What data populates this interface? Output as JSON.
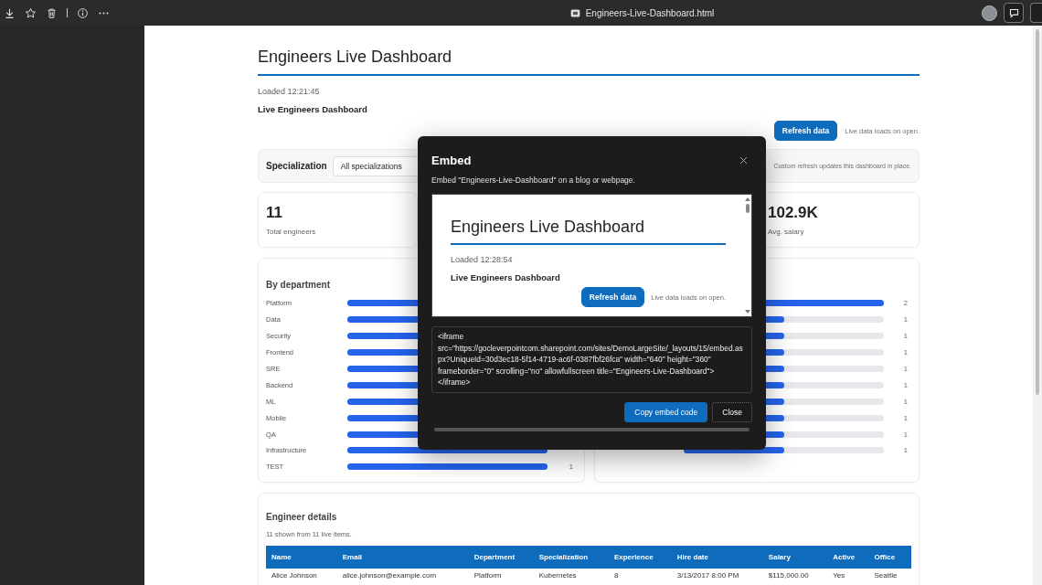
{
  "browser": {
    "tab_title": "Engineers-Live-Dashboard.html"
  },
  "page": {
    "title": "Engineers Live Dashboard",
    "loaded": "Loaded 12:21:45",
    "subtitle": "Live Engineers Dashboard",
    "refresh_button": "Refresh data",
    "refresh_note": "Live data loads on open.",
    "filter": {
      "label": "Specialization",
      "value": "All specializations",
      "note": "Custom refresh updates this dashboard in place."
    },
    "stats": [
      {
        "value": "11",
        "label": "Total engineers"
      },
      {
        "value": "102.9K",
        "label": "Avg. salary"
      }
    ],
    "charts": [
      {
        "title": "By department",
        "rows": [
          {
            "label": "Platform",
            "level": 1
          },
          {
            "label": "Data",
            "level": 1
          },
          {
            "label": "Security",
            "level": 1
          },
          {
            "label": "Frontend",
            "level": 1
          },
          {
            "label": "SRE",
            "level": 1
          },
          {
            "label": "Backend",
            "level": 1
          },
          {
            "label": "ML",
            "level": 1
          },
          {
            "label": "Mobile",
            "level": 1
          },
          {
            "label": "QA",
            "level": 1
          },
          {
            "label": "Infrastructure",
            "level": 1
          },
          {
            "label": "TEST",
            "level": 1,
            "value": "1"
          }
        ]
      },
      {
        "rows": [
          {
            "level": 1,
            "value": "2"
          },
          {
            "level": 0.5,
            "value": "1"
          },
          {
            "level": 0.5,
            "value": "1"
          },
          {
            "level": 0.5,
            "value": "1"
          },
          {
            "level": 0.5,
            "value": "1"
          },
          {
            "level": 0.5,
            "value": "1"
          },
          {
            "level": 0.5,
            "value": "1"
          },
          {
            "level": 0.5,
            "value": "1"
          },
          {
            "level": 0.5,
            "value": "1"
          },
          {
            "level": 0.5,
            "value": "1"
          }
        ]
      }
    ],
    "table": {
      "title": "Engineer details",
      "subtitle": "11 shown from 11 live items.",
      "columns": [
        "Name",
        "Email",
        "Department",
        "Specialization",
        "Experience",
        "Hire date",
        "Salary",
        "Active",
        "Office"
      ],
      "rows": [
        [
          "Alice Johnson",
          "alice.johnson@example.com",
          "Platform",
          "Kubernetes",
          "8",
          "3/13/2017 8:00 PM",
          "$115,000.00",
          "Yes",
          "Seattle"
        ]
      ]
    }
  },
  "modal": {
    "title": "Embed",
    "description": "Embed \"Engineers-Live-Dashboard\" on a blog or webpage.",
    "preview": {
      "title": "Engineers Live Dashboard",
      "loaded": "Loaded 12:28:54",
      "subtitle": "Live Engineers Dashboard",
      "button": "Refresh data",
      "note": "Live data loads on open."
    },
    "code": "<iframe src=\"https://gocleverpointcom.sharepoint.com/sites/DemoLargeSite/_layouts/15/embed.aspx?UniqueId=30d3ec18-5f14-4719-ac6f-0387fbf26fca\" width=\"640\" height=\"360\" frameborder=\"0\" scrolling=\"no\" allowfullscreen title=\"Engineers-Live-Dashboard\"></iframe>",
    "buttons": [
      {
        "label": "Copy embed code",
        "kind": "primary"
      },
      {
        "label": "Close",
        "kind": "secondary"
      }
    ]
  }
}
